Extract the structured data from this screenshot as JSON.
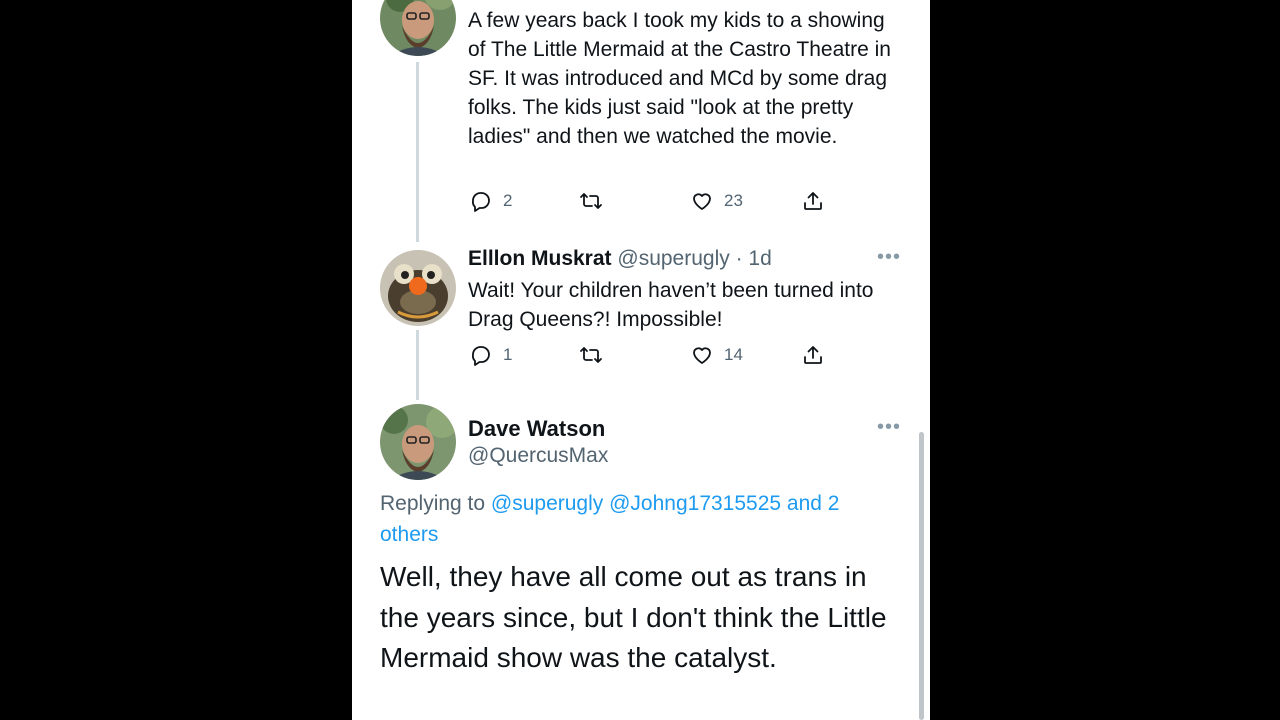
{
  "tweets": [
    {
      "text": "A few years back I took my kids to a showing of The Little Mermaid at the Castro Theatre in SF. It was introduced and MCd by some drag folks. The kids just said \"look at the pretty ladies\" and then we watched the movie.",
      "replies": "2",
      "likes": "23"
    },
    {
      "name": "Elllon Muskrat",
      "handle": "@superugly",
      "time": "· 1d",
      "text": "Wait! Your children haven’t been turned into Drag Queens?! Impossible!",
      "replies": "1",
      "likes": "14"
    }
  ],
  "main_tweet": {
    "name": "Dave Watson",
    "handle": "@QuercusMax",
    "replying_prefix": "Replying to",
    "replying_to": "@superugly @Johng17315525 and 2 others",
    "text": "Well, they have all come out as trans in the years since, but I don't think the Little Mermaid show was the catalyst."
  },
  "icons": {
    "reply": "reply-icon",
    "retweet": "retweet-icon",
    "like": "heart-icon",
    "share": "share-icon",
    "more": "more-icon"
  },
  "colors": {
    "link": "#1d9bf0",
    "secondary_text": "#536471",
    "thread_line": "#cfd9de"
  }
}
